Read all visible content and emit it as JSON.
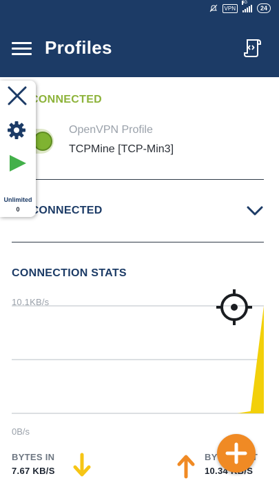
{
  "status_bar": {
    "vpn_badge": "VPN",
    "network": "4G",
    "battery": "24"
  },
  "app_bar": {
    "title": "Profiles",
    "menu_icon": "hamburger-icon",
    "action_icon": "import-profile-icon"
  },
  "connected": {
    "header": "CONNECTED",
    "profile": {
      "name": "OpenVPN Profile",
      "server": "TCPMine [TCP-Min3]",
      "toggle_on": true
    }
  },
  "disconnected": {
    "header": "DISCONNECTED"
  },
  "stats": {
    "header": "CONNECTION STATS",
    "axis_max": "10.1KB/s",
    "axis_min": "0B/s",
    "bytes_in": {
      "label": "BYTES IN",
      "value": "7.67 KB/S"
    },
    "bytes_out": {
      "label": "BYTES OUT",
      "value": "10.34 KB/S"
    }
  },
  "overlay": {
    "label": "Unlimited",
    "count": "0"
  },
  "colors": {
    "brand": "#1c3b66",
    "connected": "#8db33a",
    "toggle": "#7fb331",
    "fab": "#f08a24",
    "download_arrow": "#f6c515",
    "upload_arrow": "#f08a24",
    "graph_fill": "#f2d00a"
  },
  "chart_data": {
    "type": "area",
    "x": [
      0,
      1,
      2,
      3,
      4,
      5,
      6,
      7,
      8,
      9,
      10,
      11,
      12,
      13,
      14,
      15,
      16,
      17,
      18,
      19
    ],
    "series": [
      {
        "values": [
          0,
          0,
          0,
          0,
          0,
          0,
          0,
          0,
          0,
          0,
          0,
          0,
          0,
          0,
          0,
          0,
          0,
          0,
          0.2,
          10.1
        ]
      }
    ],
    "ylim": [
      0,
      10.1
    ],
    "grid": true
  }
}
